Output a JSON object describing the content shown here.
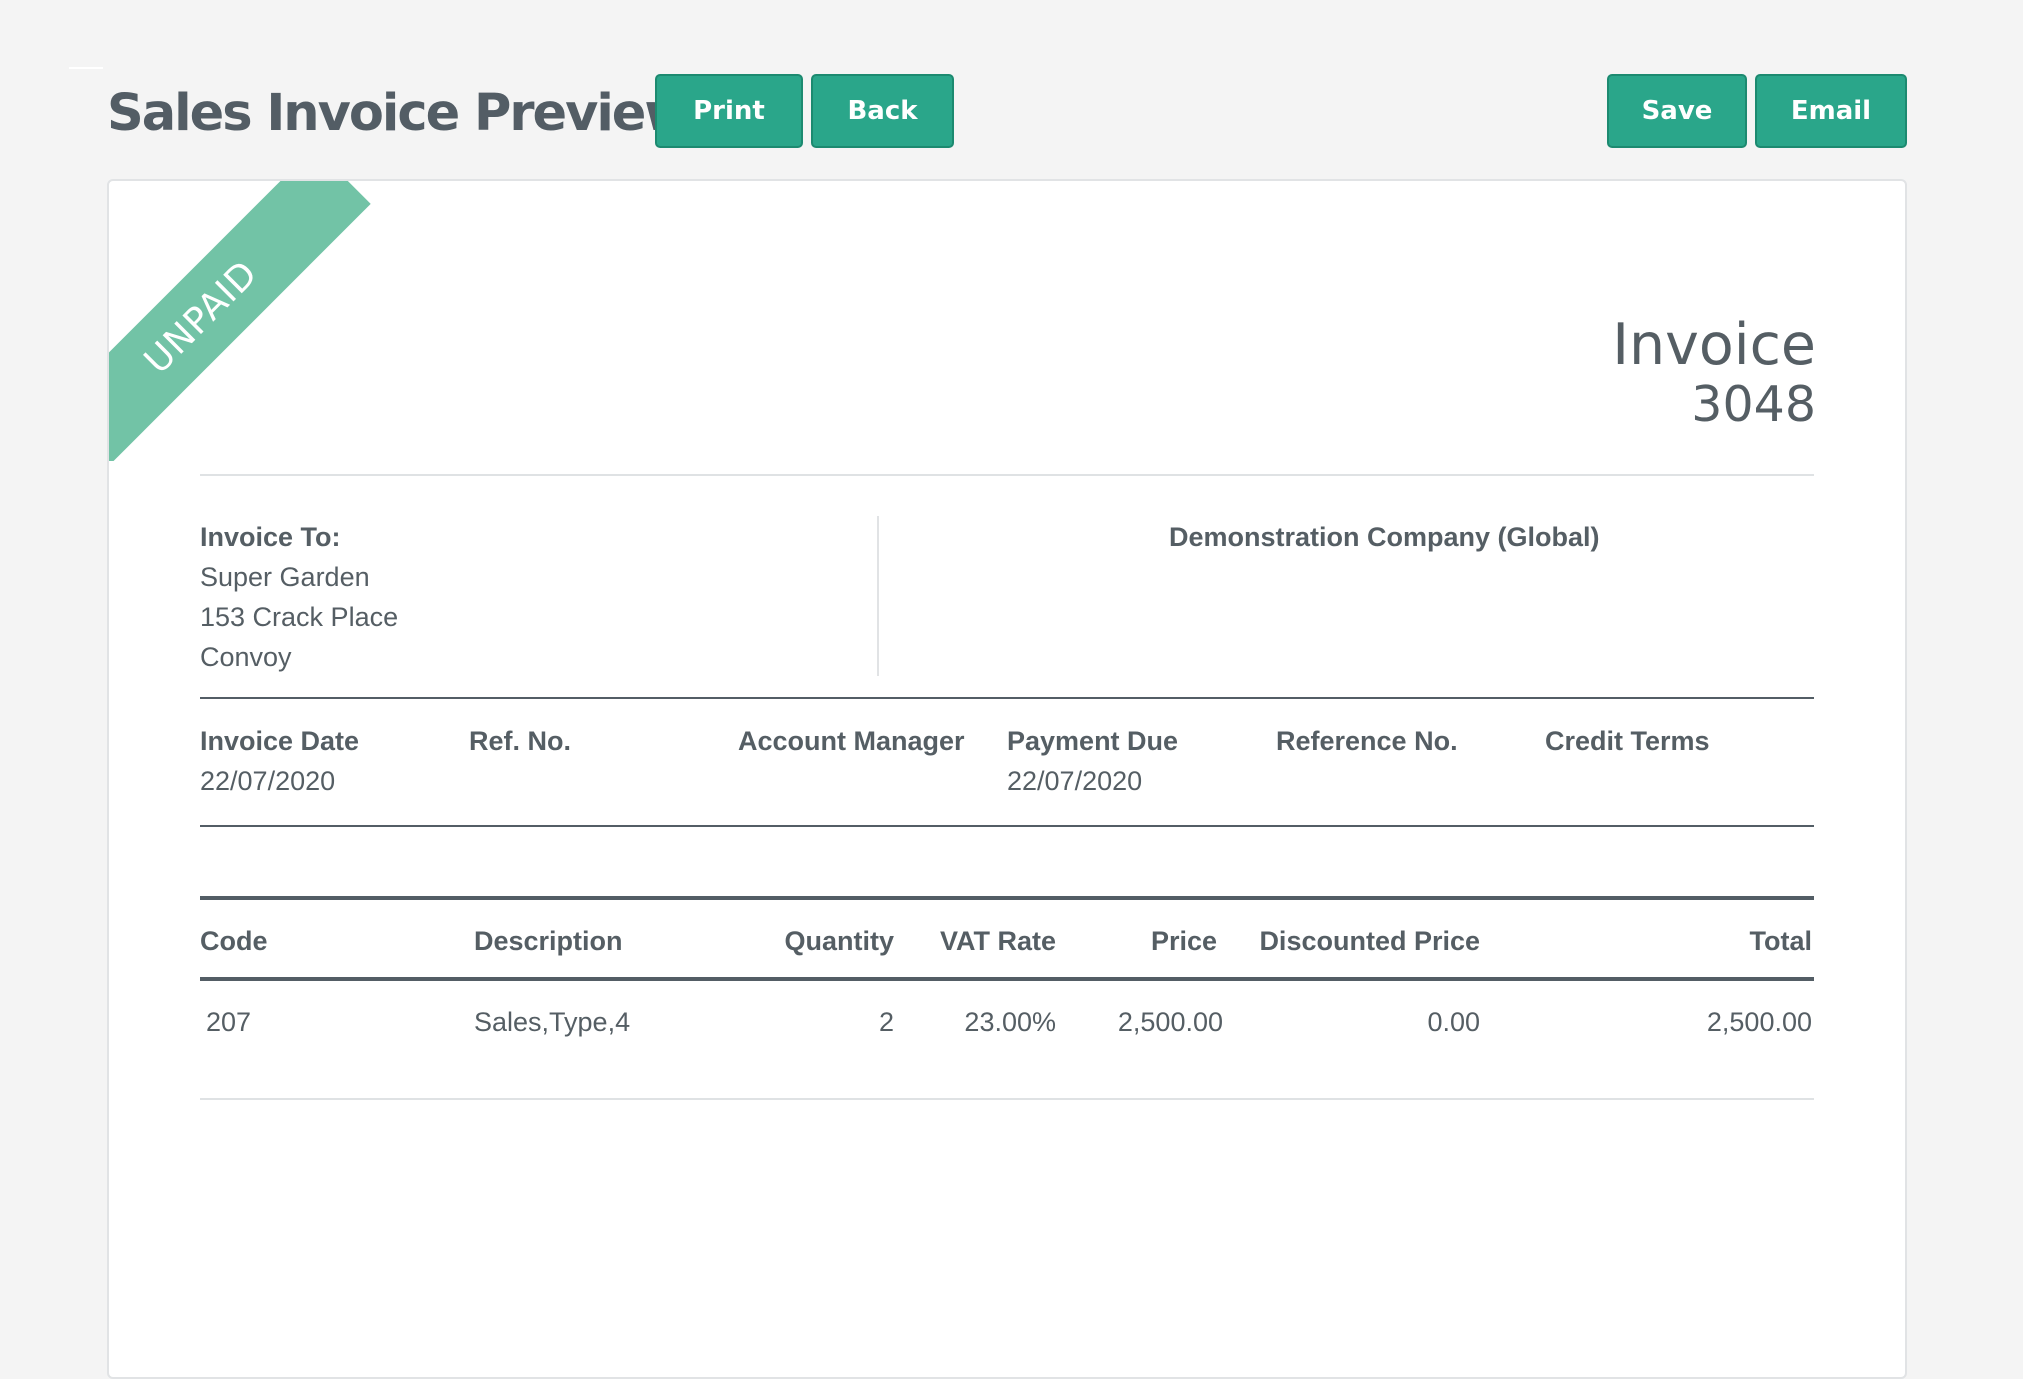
{
  "header": {
    "title": "Sales Invoice Preview",
    "buttons": {
      "print": "Print",
      "back": "Back",
      "save": "Save",
      "email": "Email"
    }
  },
  "invoice": {
    "status_ribbon": "UNPAID",
    "heading": "Invoice",
    "number": "3048",
    "bill_to": {
      "label": "Invoice To:",
      "name": "Super Garden",
      "address_line1": "153 Crack Place",
      "address_line2": "Convoy"
    },
    "company": "Demonstration Company (Global)",
    "meta": [
      {
        "label": "Invoice Date",
        "value": "22/07/2020"
      },
      {
        "label": "Ref. No.",
        "value": ""
      },
      {
        "label": "Account Manager",
        "value": ""
      },
      {
        "label": "Payment Due",
        "value": "22/07/2020"
      },
      {
        "label": "Reference No.",
        "value": ""
      },
      {
        "label": "Credit Terms",
        "value": ""
      }
    ],
    "table": {
      "headers": {
        "code": "Code",
        "description": "Description",
        "quantity": "Quantity",
        "vat_rate": "VAT Rate",
        "price": "Price",
        "discounted_price": "Discounted Price",
        "total": "Total"
      },
      "rows": [
        {
          "code": "207",
          "description": "Sales,Type,4",
          "quantity": "2",
          "vat_rate": "23.00%",
          "price": "2,500.00",
          "discounted_price": "0.00",
          "total": "2,500.00"
        }
      ]
    }
  },
  "colors": {
    "accent": "#2aa68a",
    "ribbon": "#72c3a6",
    "text": "#555e64",
    "background": "#f4f4f4"
  }
}
